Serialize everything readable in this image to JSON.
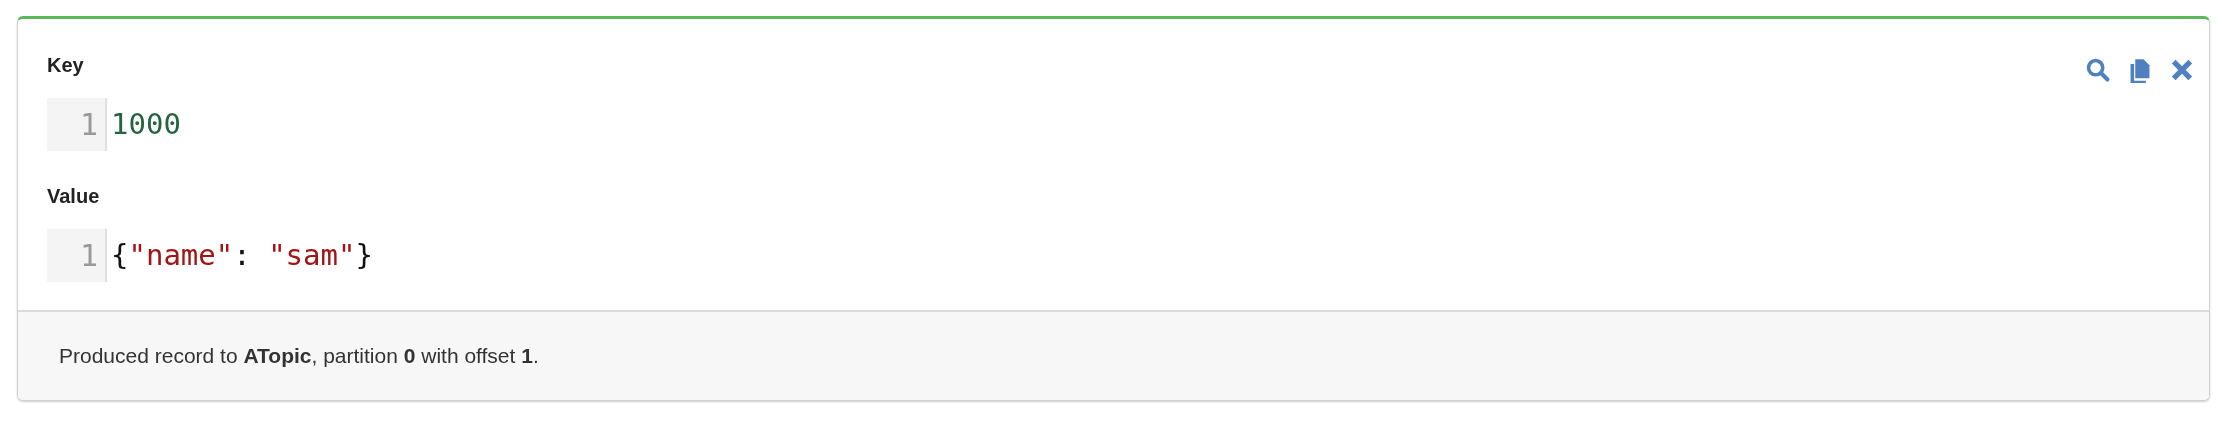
{
  "fields": [
    {
      "label": "Key",
      "lines": [
        {
          "number": "1",
          "tokens": [
            {
              "kind": "number",
              "text": "1000"
            }
          ]
        }
      ]
    },
    {
      "label": "Value",
      "lines": [
        {
          "number": "1",
          "tokens": [
            {
              "kind": "punct",
              "text": "{"
            },
            {
              "kind": "string",
              "text": "\"name\""
            },
            {
              "kind": "punct",
              "text": ": "
            },
            {
              "kind": "string",
              "text": "\"sam\""
            },
            {
              "kind": "punct",
              "text": "}"
            }
          ]
        }
      ]
    }
  ],
  "actions": [
    {
      "kind": "search"
    },
    {
      "kind": "copy"
    },
    {
      "kind": "close"
    }
  ],
  "message": "Produced record to **ATopic**, partition **0** with offset **1**."
}
